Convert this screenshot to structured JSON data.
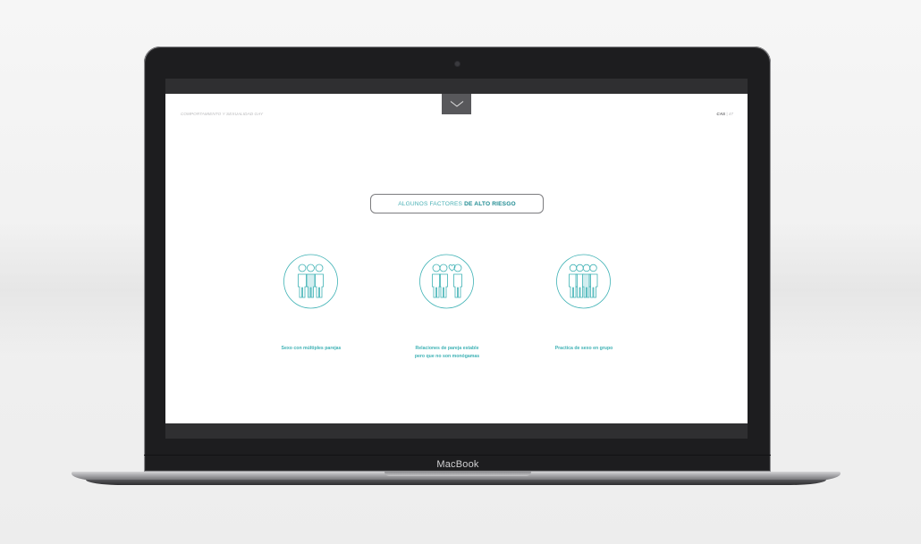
{
  "laptop": {
    "brand_label": "MacBook"
  },
  "screen": {
    "document_title": "COMPORTAMIENTO Y SEXUALIDAD GAY",
    "language": "CAS",
    "page_separator": "|",
    "page_number": "47",
    "menu_icon": "chevron-down-icon",
    "section_heading": {
      "light": "ALGUNOS FACTORES",
      "bold": "DE ALTO RIESGO"
    },
    "factors": [
      {
        "icon": "three-people-icon",
        "caption_lines": [
          "Sexo con múltiples parejas"
        ]
      },
      {
        "icon": "couple-with-heart-icon",
        "caption_lines": [
          "Relaciones de pareja estable",
          "pero que no son monógamas"
        ]
      },
      {
        "icon": "group-people-icon",
        "caption_lines": [
          "Practica de sexo en grupo"
        ]
      }
    ]
  },
  "colors": {
    "accent": "#3fb2b5",
    "accent_dark": "#1f8b92",
    "icon_fill": "#d3eef0",
    "bar_dark": "#2f2f31",
    "menu_tab": "#58585b"
  }
}
